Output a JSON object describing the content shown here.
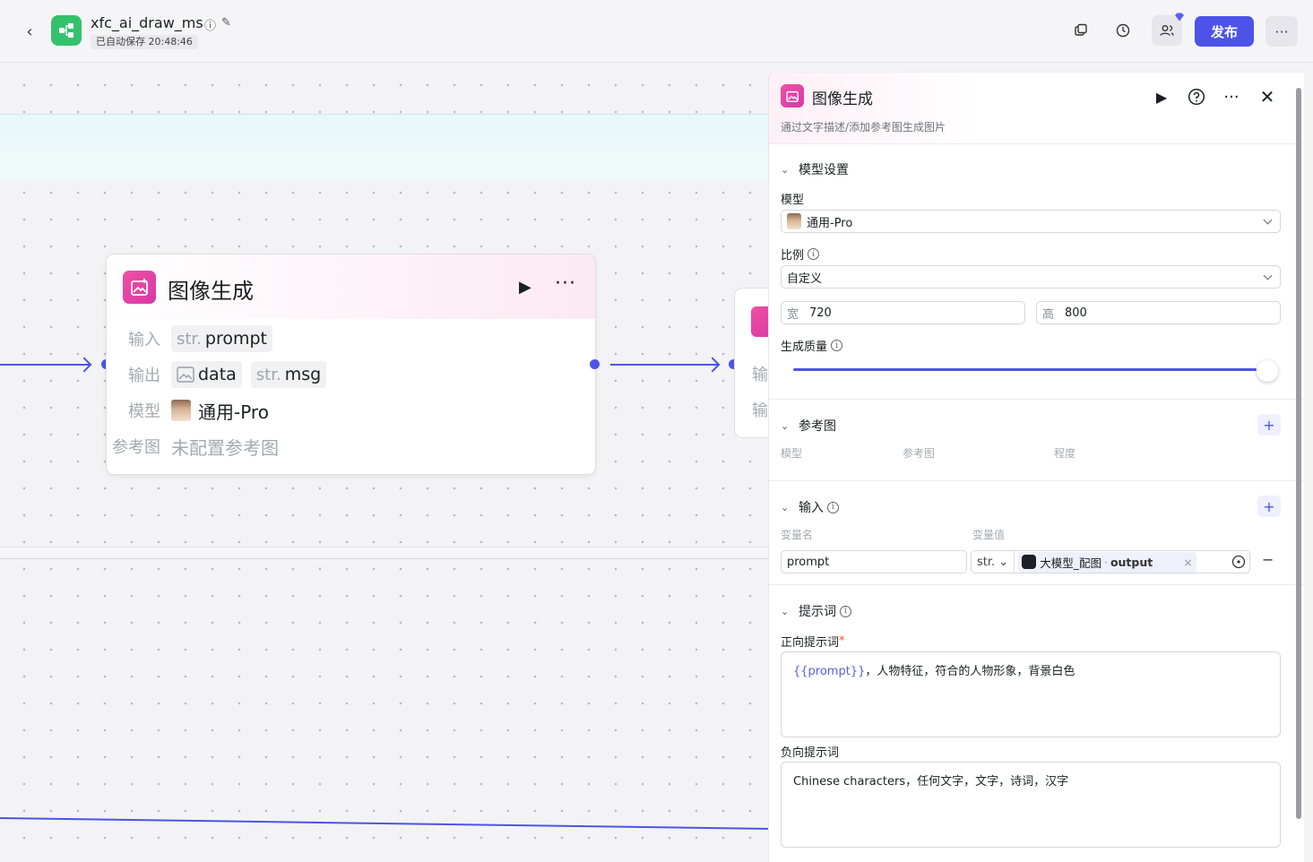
{
  "header": {
    "back_label": "‹",
    "app_title": "xfc_ai_draw_ms",
    "autosave": "已自动保存 20:48:46",
    "publish_label": "发布",
    "more_label": "···",
    "accent": "#4d53e8",
    "logo_color": "#33c26b"
  },
  "canvas": {
    "node": {
      "title": "图像生成",
      "input_label": "输入",
      "input_type": "str.",
      "input_name": "prompt",
      "output_label": "输出",
      "output1_name": "data",
      "output2_type": "str.",
      "output2_name": "msg",
      "model_label": "模型",
      "model_value": "通用-Pro",
      "ref_label": "参考图",
      "ref_value": "未配置参考图"
    },
    "node2": {
      "row1": "输",
      "row2": "输"
    }
  },
  "panel": {
    "title": "图像生成",
    "description": "通过文字描述/添加参考图生成图片",
    "model_section": {
      "title": "模型设置",
      "model_label": "模型",
      "model_value": "通用-Pro",
      "ratio_label": "比例",
      "ratio_value": "自定义",
      "width_prefix": "宽",
      "width_value": "720",
      "height_prefix": "高",
      "height_value": "800",
      "quality_label": "生成质量",
      "quality_fraction": 1.0
    },
    "ref_section": {
      "title": "参考图",
      "col_model": "模型",
      "col_ref": "参考图",
      "col_degree": "程度"
    },
    "input_section": {
      "title": "输入",
      "col_name": "变量名",
      "col_value": "变量值",
      "var_name": "prompt",
      "var_type": "str.",
      "var_ref_node": "大模型_配图",
      "var_ref_sep": "·",
      "var_ref_field": "output"
    },
    "prompt_section": {
      "title": "提示词",
      "positive_label": "正向提示词",
      "positive_required": "*",
      "positive_var": "{{prompt}}",
      "positive_text": "，人物特征，符合的人物形象，背景白色",
      "negative_label": "负向提示词",
      "negative_text": "Chinese characters，任何文字，文字，诗词，汉字"
    }
  }
}
